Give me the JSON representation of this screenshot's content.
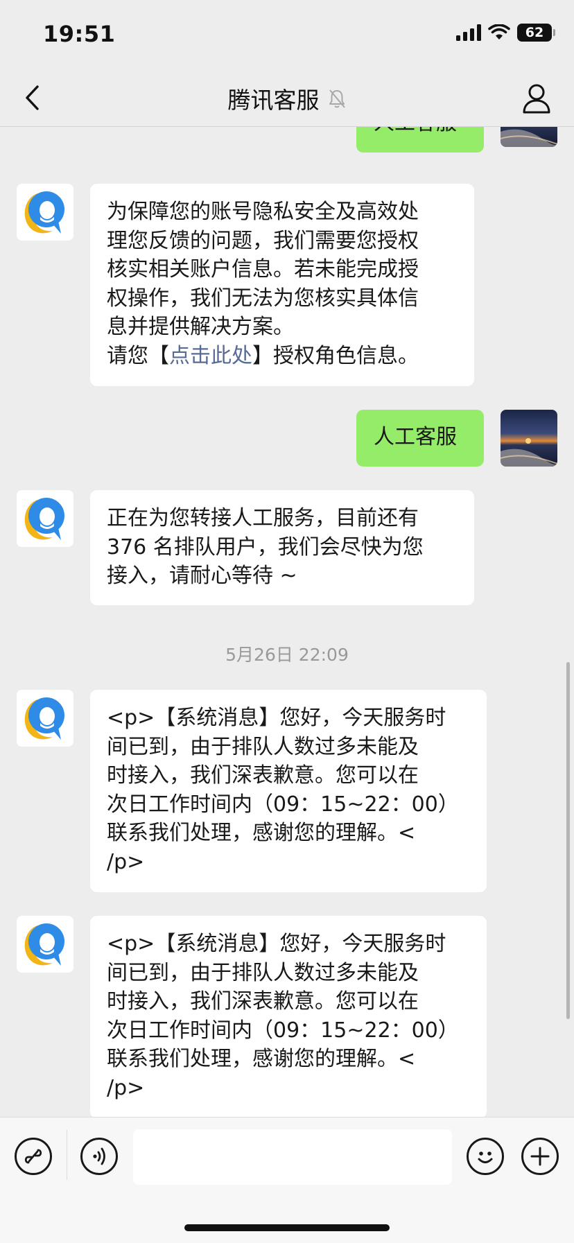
{
  "status_bar": {
    "time": "19:51",
    "battery": "62"
  },
  "header": {
    "title": "腾讯客服"
  },
  "messages": {
    "m0": {
      "text": "人工客服"
    },
    "m1": {
      "lines": [
        "为保障您的账号隐私安全及高效处",
        "理您反馈的问题，我们需要您授权",
        "核实相关账户信息。若未能完成授",
        "权操作，我们无法为您核实具体信",
        "息并提供解决方案。"
      ],
      "prefix": "请您【",
      "link": "点击此处",
      "suffix": "】授权角色信息。"
    },
    "m2": {
      "text": "人工客服"
    },
    "m3": {
      "lines": [
        "正在为您转接人工服务，目前还有",
        "376 名排队用户，我们会尽快为您",
        "接入，请耐心等待 ~"
      ]
    },
    "timestamp": "5月26日 22:09",
    "m4": {
      "lines": [
        "<p>【系统消息】您好，今天服务时",
        "间已到，由于排队人数过多未能及",
        "时接入，我们深表歉意。您可以在",
        "次日工作时间内（09：15~22：00）",
        "联系我们处理，感谢您的理解。<",
        "/p>"
      ]
    },
    "m5": {
      "lines": [
        "<p>【系统消息】您好，今天服务时",
        "间已到，由于排队人数过多未能及",
        "时接入，我们深表歉意。您可以在",
        "次日工作时间内（09：15~22：00）",
        "联系我们处理，感谢您的理解。<",
        "/p>"
      ]
    }
  },
  "input": {
    "placeholder": ""
  },
  "icons": {
    "back": "chevron-left-icon",
    "mute": "bell-muted-icon",
    "profile": "person-icon",
    "mini_program": "link-icon",
    "voice": "voice-icon",
    "emoji": "emoji-icon",
    "more": "plus-icon"
  },
  "colors": {
    "user_bubble": "#95ec69",
    "bot_bubble": "#ffffff",
    "link": "#576b95",
    "background": "#ededed"
  }
}
